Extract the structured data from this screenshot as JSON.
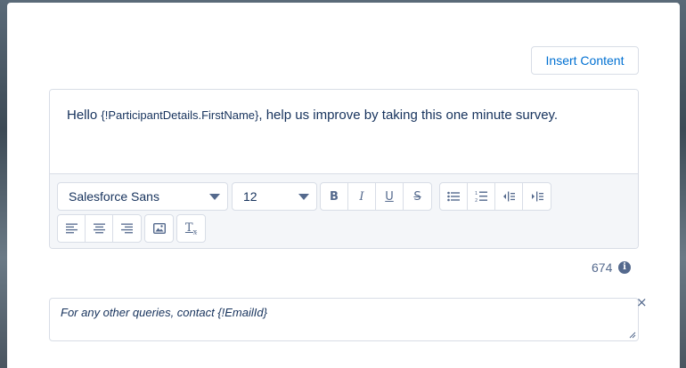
{
  "insert_content_label": "Insert Content",
  "editor": {
    "text_prefix": "Hello ",
    "merge_field": "{!ParticipantDetails.FirstName}",
    "text_suffix": ", help us improve by taking this one minute survey."
  },
  "toolbar": {
    "font_family": "Salesforce Sans",
    "font_size": "12",
    "buttons_format": [
      "bold-icon",
      "italic-icon",
      "underline-icon",
      "strikethrough-icon"
    ],
    "buttons_list": [
      "bulleted-list-icon",
      "numbered-list-icon",
      "outdent-icon",
      "indent-icon"
    ],
    "buttons_align": [
      "align-left-icon",
      "align-center-icon",
      "align-right-icon"
    ],
    "buttons_other": [
      "image-icon",
      "clear-formatting-icon"
    ]
  },
  "character_count": "674",
  "footer_text": "For any other queries, contact {!EmailId}",
  "close_symbol": "×"
}
